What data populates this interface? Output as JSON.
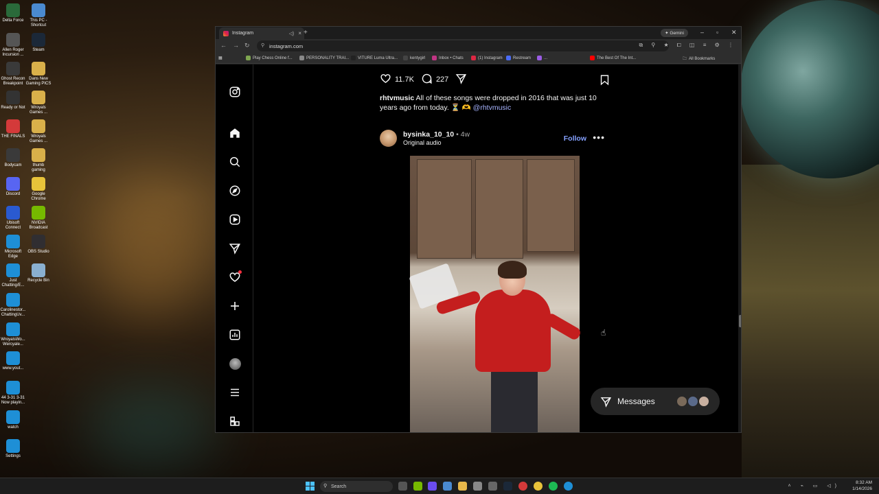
{
  "desktop": {
    "icons": [
      {
        "label": "Delta Force",
        "color": "#2a6a3a"
      },
      {
        "label": "This PC - Shortcut",
        "color": "#4a8ad0"
      },
      {
        "label": "Allen Roger Incursion ...",
        "color": "#555"
      },
      {
        "label": "Steam",
        "color": "#1b2838"
      },
      {
        "label": "Ghost Recon Breakpoint",
        "color": "#3a3a3a"
      },
      {
        "label": "Dans New Gaming PICS",
        "color": "#d9b04a"
      },
      {
        "label": "Ready or Not",
        "color": "#333"
      },
      {
        "label": "Wroyals Games ...",
        "color": "#d9b04a"
      },
      {
        "label": "THE FINALS",
        "color": "#d43a3a"
      },
      {
        "label": "Wroyals Games ...",
        "color": "#d9b04a"
      },
      {
        "label": "Bodycam",
        "color": "#3a3a3a"
      },
      {
        "label": "thumb gaming",
        "color": "#d9b04a"
      },
      {
        "label": "Discord",
        "color": "#5865f2"
      },
      {
        "label": "Google Chrome",
        "color": "#e8c33a"
      },
      {
        "label": "Ubisoft Connect",
        "color": "#2a5ad0"
      },
      {
        "label": "NVIDIA Broadcast",
        "color": "#76b900"
      },
      {
        "label": "Microsoft Edge",
        "color": "#1e8fd6"
      },
      {
        "label": "OBS Studio",
        "color": "#302e31"
      },
      {
        "label": "Just Chatting/E...",
        "color": "#1e8fd6"
      },
      {
        "label": "Recycle Bin",
        "color": "#8ab0d0"
      },
      {
        "label": "Carolinestor... ChattingUv...",
        "color": "#1e8fd6"
      },
      {
        "label": "WroyalsWo... Wercyale...",
        "color": "#1e8fd6"
      },
      {
        "label": "www.yout...",
        "color": "#1e8fd6"
      },
      {
        "label": "44 3-31 3-31 Now playin...",
        "color": "#1e8fd6"
      },
      {
        "label": "watch",
        "color": "#1e8fd6"
      },
      {
        "label": "Settings",
        "color": "#1e8fd6"
      }
    ]
  },
  "browser": {
    "tab_title": "Instagram",
    "new_tab": "+",
    "gemini_label": "✦ Gemini",
    "url": "instagram.com",
    "bookmarks": [
      {
        "label": "Play Chess Online f...",
        "color": "#7fa650"
      },
      {
        "label": "PERSONALITY TRAI...",
        "color": "#888"
      },
      {
        "label": "VITURE Luma Ultra...",
        "color": "#222"
      },
      {
        "label": "kentygirl",
        "color": "#444"
      },
      {
        "label": "Inbox • Chats",
        "color": "#c13584"
      },
      {
        "label": "(1) Instagram",
        "color": "#dc2743"
      },
      {
        "label": "Restream",
        "color": "#4a6cf7"
      },
      {
        "label": "...",
        "color": "#9b5de5"
      },
      {
        "label": "The Best Of The Int...",
        "color": "#ff0000"
      }
    ],
    "all_bookmarks": "All Bookmarks"
  },
  "instagram": {
    "likes": "11.7K",
    "comments": "227",
    "caption_user": "rhtvmusic",
    "caption_text": " All of these songs were dropped in 2016 that was just 10 years ago from today. ⏳ 🫶 ",
    "caption_mention": "@rhtvmusic",
    "post_user": "bysinka_10_10",
    "post_time": " • 4w",
    "post_audio": "Original audio",
    "follow_label": "Follow",
    "messages_label": "Messages"
  },
  "taskbar": {
    "search_placeholder": "Search",
    "time": "8:32 AM",
    "date": "1/14/2026"
  }
}
